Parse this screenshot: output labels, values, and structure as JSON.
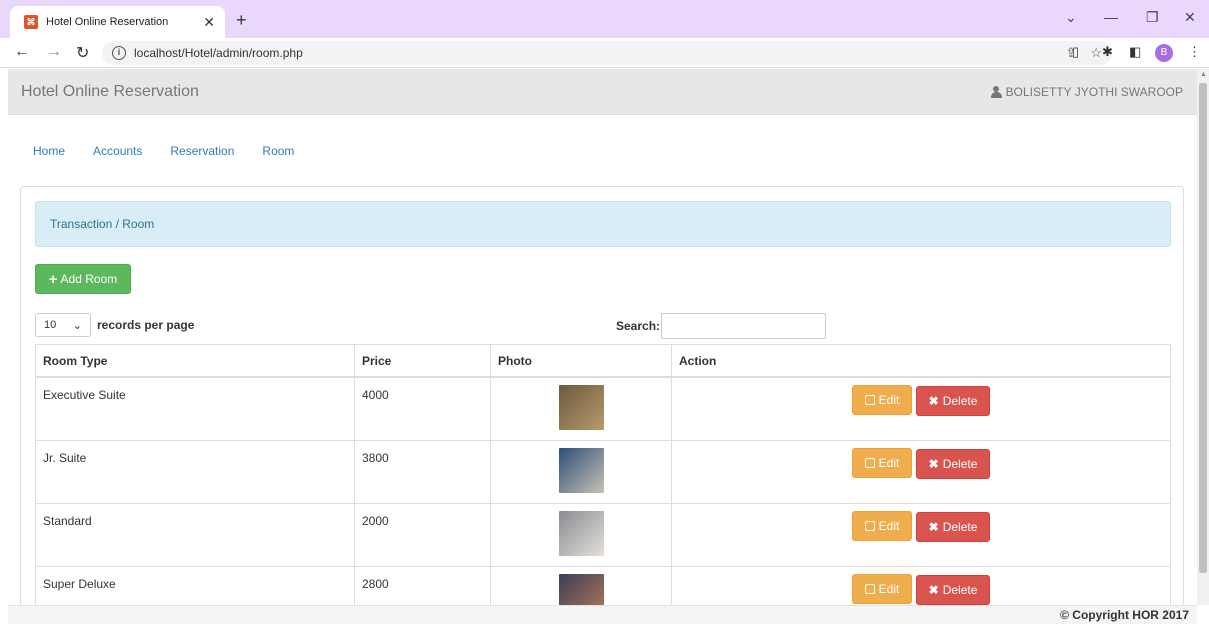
{
  "browser": {
    "tab_title": "Hotel Online Reservation",
    "url": "localhost/Hotel/admin/room.php",
    "profile_initial": "B"
  },
  "navbar": {
    "brand": "Hotel Online Reservation",
    "user": "BOLISETTY JYOTHI SWAROOP"
  },
  "menu": {
    "items": [
      "Home",
      "Accounts",
      "Reservation",
      "Room"
    ]
  },
  "breadcrumb": "Transaction / Room",
  "add_button": "Add Room",
  "table_controls": {
    "length_value": "10",
    "length_label": "records per page",
    "search_label": "Search:"
  },
  "table": {
    "headers": [
      "Room Type",
      "Price",
      "Photo",
      "Action"
    ],
    "rows": [
      {
        "type": "Executive Suite",
        "price": "4000",
        "photo_colors": [
          "#6b5a3e",
          "#b89a6a"
        ]
      },
      {
        "type": "Jr. Suite",
        "price": "3800",
        "photo_colors": [
          "#2c4f7a",
          "#c8c2b4"
        ]
      },
      {
        "type": "Standard",
        "price": "2000",
        "photo_colors": [
          "#8a8c92",
          "#e4e0d8"
        ]
      },
      {
        "type": "Super Deluxe",
        "price": "2800",
        "photo_colors": [
          "#3a3f5a",
          "#b77a55"
        ]
      }
    ],
    "edit_label": "Edit",
    "delete_label": "Delete"
  },
  "footer": "© Copyright HOR 2017",
  "colors": {
    "success": "#5cb85c",
    "warning": "#f0ad4e",
    "danger": "#d9534f",
    "link": "#337ab7"
  }
}
